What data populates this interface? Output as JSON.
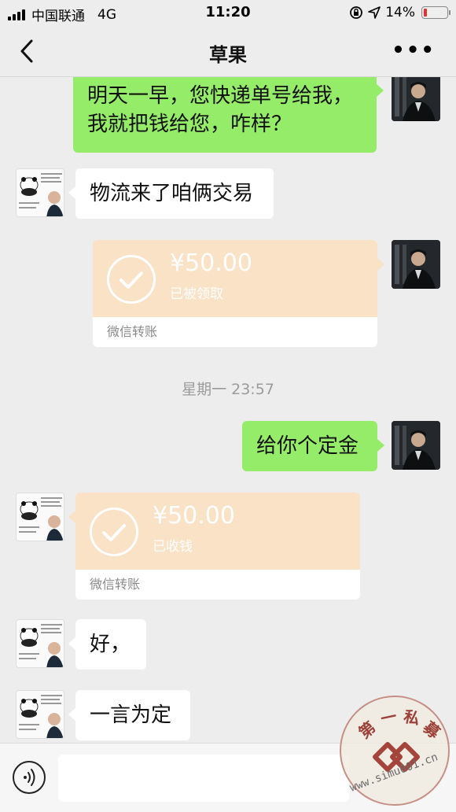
{
  "status_bar": {
    "carrier": "中国联通",
    "network": "4G",
    "time": "11:20",
    "battery_percent": "14%",
    "battery_level": 0.14,
    "battery_color": "#e5322d"
  },
  "nav": {
    "back_icon": "chevron-left-icon",
    "title": "草果",
    "more_label": "•••"
  },
  "messages": {
    "m1": {
      "text": "明天一早，您快递单号给我，我就把钱给您，咋样？"
    },
    "m2": {
      "text": "物流来了咱俩交易"
    },
    "m3": {
      "amount": "¥50.00",
      "status": "已被领取",
      "label": "微信转账"
    },
    "timestamp": "星期一 23:57",
    "m4": {
      "text": "给你个定金"
    },
    "m5": {
      "amount": "¥50.00",
      "status": "已收钱",
      "label": "微信转账"
    },
    "m6": {
      "text": "好，"
    },
    "m7": {
      "text": "一言为定"
    }
  },
  "input_bar": {
    "voice_icon": "voice-icon",
    "placeholder": ""
  },
  "watermark": {
    "chars": [
      "第",
      "一",
      "私",
      "募"
    ],
    "url": "www.simu001.cn"
  },
  "colors": {
    "green_bubble": "#95ec69",
    "transfer_bg": "#f9e2c6",
    "background": "#ededed"
  }
}
